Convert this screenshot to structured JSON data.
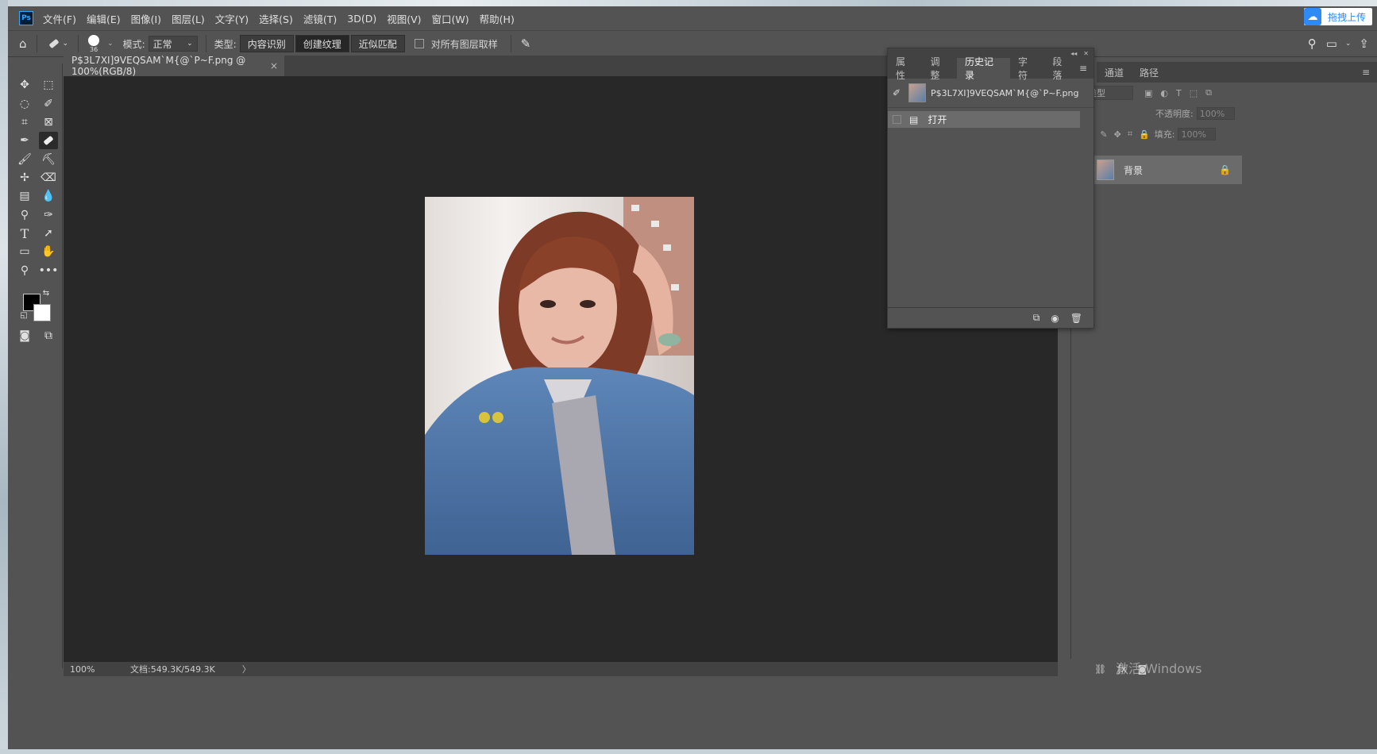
{
  "app": {
    "logo": "Ps"
  },
  "menu": [
    "文件(F)",
    "编辑(E)",
    "图像(I)",
    "图层(L)",
    "文字(Y)",
    "选择(S)",
    "滤镜(T)",
    "3D(D)",
    "视图(V)",
    "窗口(W)",
    "帮助(H)"
  ],
  "upload_label": "拖拽上传",
  "options": {
    "brush_size": "36",
    "mode_label": "模式:",
    "mode_value": "正常",
    "type_label": "类型:",
    "type_buttons": [
      "内容识别",
      "创建纹理",
      "近似匹配"
    ],
    "type_active_index": 1,
    "sample_all_label": "对所有图层取样"
  },
  "document": {
    "tab_title": "P$3L7XI]9VEQSAM`M{@`P~F.png @ 100%(RGB/8)",
    "zoom": "100%",
    "doc_size": "文档:549.3K/549.3K"
  },
  "history_panel": {
    "tabs": [
      "属性",
      "调整",
      "历史记录",
      "字符",
      "段落"
    ],
    "active_tab": 2,
    "snapshot_name": "P$3L7XI]9VEQSAM`M{@`P~F.png",
    "steps": [
      "打开"
    ]
  },
  "layers_panel": {
    "tabs": [
      "通道",
      "路径"
    ],
    "filter_type": "类型",
    "opacity_label": "不透明度:",
    "opacity_value": "100%",
    "fill_label": "填充:",
    "fill_value": "100%",
    "layers": [
      {
        "name": "背景",
        "locked": true
      }
    ]
  },
  "watermark": "激活 Windows"
}
